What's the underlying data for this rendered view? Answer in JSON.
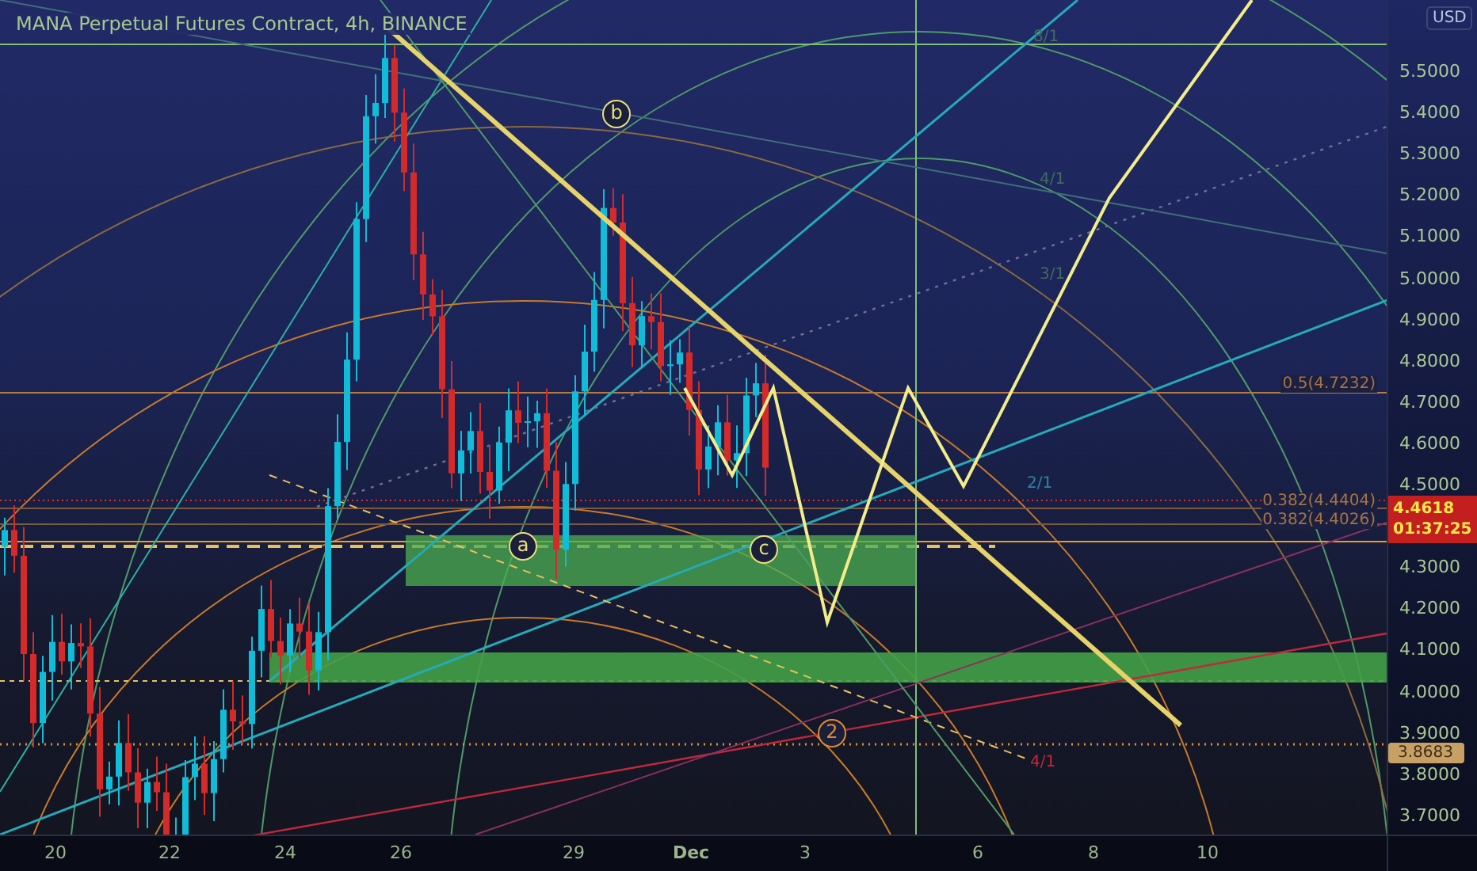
{
  "chart": {
    "title": "MANA Perpetual Futures Contract, 4h, BINANCE",
    "wave_labels": [
      {
        "text": "b",
        "color": "#e8e07a"
      },
      {
        "text": "a",
        "color": "#e8e07a"
      },
      {
        "text": "c",
        "color": "#e8e07a"
      },
      {
        "text": "2",
        "color": "#e08a2e"
      }
    ],
    "fib_labels": [
      "0.5(4.7232)",
      "0.382(4.4404)",
      "0.382(4.4026)"
    ],
    "fan_labels": [
      {
        "text": "8/1",
        "color": "#3f6e5a"
      },
      {
        "text": "4/1",
        "color": "#3f6e5a"
      },
      {
        "text": "3/1",
        "color": "#3f6e5a"
      },
      {
        "text": "2/1",
        "color": "#2a86a8"
      },
      {
        "text": "4/1",
        "color": "#c2283c"
      }
    ]
  },
  "price_axis": {
    "currency": "USD",
    "ticks": [
      "5.5000",
      "5.4000",
      "5.3000",
      "5.2000",
      "5.1000",
      "5.0000",
      "4.9000",
      "4.8000",
      "4.7000",
      "4.6000",
      "4.5000",
      "4.3000",
      "4.2000",
      "4.1000",
      "4.0000",
      "3.9000",
      "3.8000",
      "3.7000"
    ],
    "last_price": "4.4618",
    "countdown": "01:37:25",
    "level_marker": "3.8683"
  },
  "time_axis": {
    "ticks": [
      {
        "text": "20",
        "bold": false
      },
      {
        "text": "22",
        "bold": false
      },
      {
        "text": "24",
        "bold": false
      },
      {
        "text": "26",
        "bold": false
      },
      {
        "text": "29",
        "bold": false
      },
      {
        "text": "Dec",
        "bold": true
      },
      {
        "text": "3",
        "bold": false
      },
      {
        "text": "6",
        "bold": false
      },
      {
        "text": "8",
        "bold": false
      },
      {
        "text": "10",
        "bold": false
      }
    ]
  }
}
